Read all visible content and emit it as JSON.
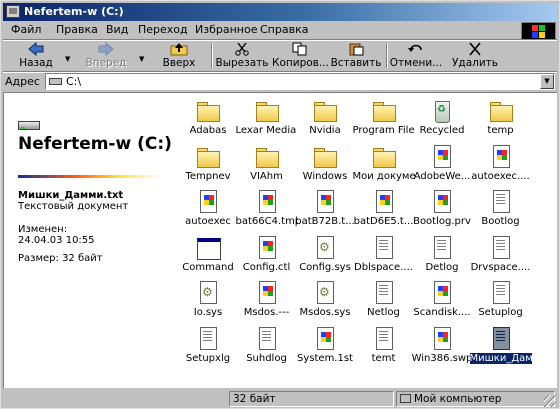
{
  "window": {
    "title": "Nefertem-w (C:)"
  },
  "menu": [
    {
      "label": "Файл"
    },
    {
      "label": "Правка"
    },
    {
      "label": "Вид"
    },
    {
      "label": "Переход"
    },
    {
      "label": "Избранное"
    },
    {
      "label": "Справка"
    }
  ],
  "toolbar": {
    "back": "Назад",
    "forward": "Вперед",
    "up": "Вверх",
    "cut": "Вырезать",
    "copy": "Копиров...",
    "paste": "Вставить",
    "undo": "Отмени...",
    "delete": "Удалить"
  },
  "address": {
    "label": "Адрес",
    "value": "C:\\"
  },
  "webview": {
    "title": "Nefertem-w (C:)",
    "file_name": "Мишки_Дамми.txt",
    "file_type": "Текстовый документ",
    "modified_label": "Изменен:",
    "modified_value": "24.04.03 10:55",
    "size": "Размер: 32 байт"
  },
  "files": [
    {
      "name": "Adabas",
      "icon": "folder-icon"
    },
    {
      "name": "Lexar Media USB Famil...",
      "icon": "folder-icon"
    },
    {
      "name": "Nvidia",
      "icon": "folder-icon"
    },
    {
      "name": "Program Files",
      "icon": "folder-icon"
    },
    {
      "name": "Recycled",
      "icon": "recycle-bin-icon"
    },
    {
      "name": "temp",
      "icon": "folder-icon"
    },
    {
      "name": "Tempnev",
      "icon": "folder-icon"
    },
    {
      "name": "VIAhm",
      "icon": "folder-icon"
    },
    {
      "name": "Windows",
      "icon": "folder-icon"
    },
    {
      "name": "Мои докумен...",
      "icon": "folder-icon"
    },
    {
      "name": "AdobeWe...",
      "icon": "windows-file-icon"
    },
    {
      "name": "autoexec....",
      "icon": "windows-file-icon"
    },
    {
      "name": "autoexec",
      "icon": "windows-file-icon"
    },
    {
      "name": "bat66C4.tmp",
      "icon": "windows-file-icon"
    },
    {
      "name": "batB72B.t...",
      "icon": "windows-file-icon"
    },
    {
      "name": "batD6E5.t...",
      "icon": "windows-file-icon"
    },
    {
      "name": "Bootlog.prv",
      "icon": "windows-file-icon"
    },
    {
      "name": "Bootlog",
      "icon": "text-file-icon"
    },
    {
      "name": "Command",
      "icon": "ms-dos-program-icon"
    },
    {
      "name": "Config.ctl",
      "icon": "windows-file-icon"
    },
    {
      "name": "Config.sys",
      "icon": "system-file-icon"
    },
    {
      "name": "Dblspace....",
      "icon": "text-file-icon"
    },
    {
      "name": "Detlog",
      "icon": "text-file-icon"
    },
    {
      "name": "Drvspace....",
      "icon": "text-file-icon"
    },
    {
      "name": "Io.sys",
      "icon": "system-file-icon"
    },
    {
      "name": "Msdos.---",
      "icon": "windows-file-icon"
    },
    {
      "name": "Msdos.sys",
      "icon": "system-file-icon"
    },
    {
      "name": "Netlog",
      "icon": "text-file-icon"
    },
    {
      "name": "Scandisk....",
      "icon": "windows-file-icon"
    },
    {
      "name": "Setuplog",
      "icon": "text-file-icon"
    },
    {
      "name": "Setupxlg",
      "icon": "text-file-icon"
    },
    {
      "name": "Suhdlog",
      "icon": "text-file-icon"
    },
    {
      "name": "System.1st",
      "icon": "windows-file-icon"
    },
    {
      "name": "temt",
      "icon": "text-file-icon"
    },
    {
      "name": "Win386.swp",
      "icon": "windows-file-icon"
    },
    {
      "name": "Мишки_Дамми",
      "icon": "text-file-icon",
      "selected": true
    }
  ],
  "status": {
    "size": "32 байт",
    "location": "Мой компьютер"
  }
}
